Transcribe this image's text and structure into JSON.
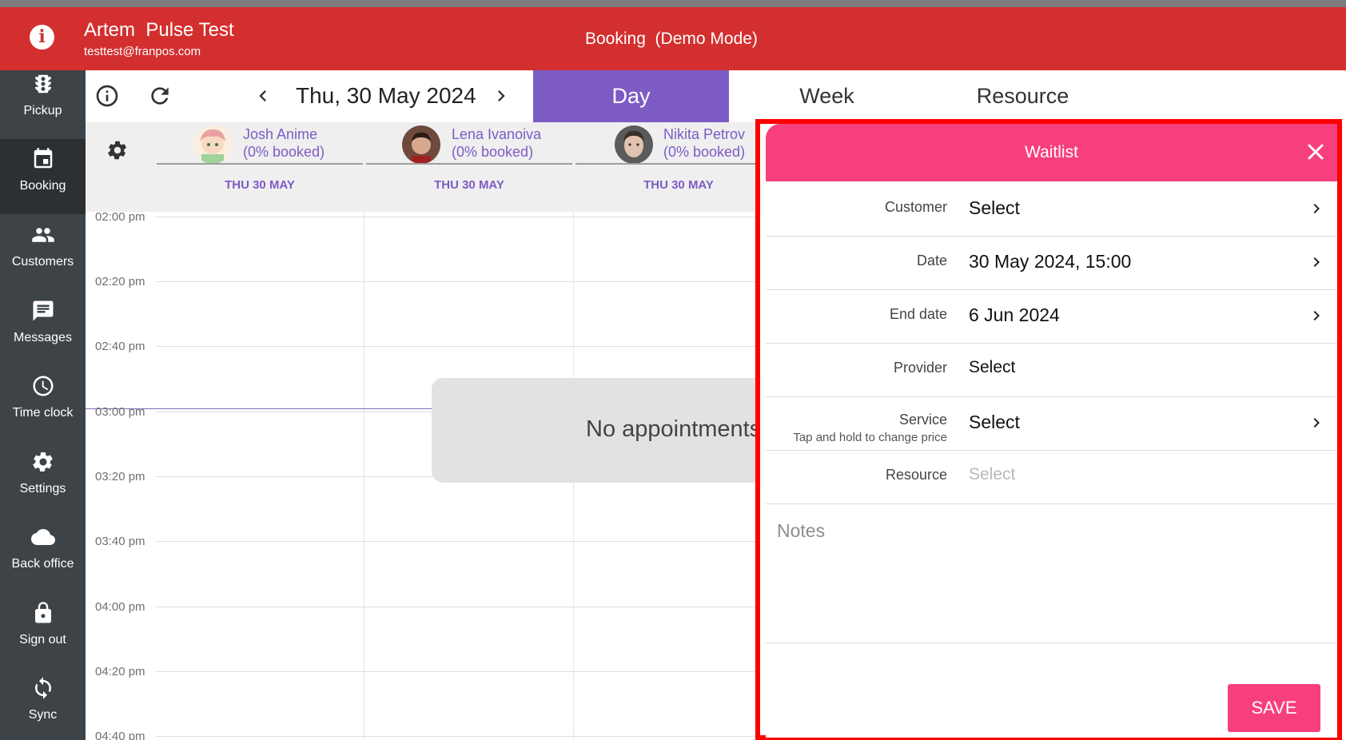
{
  "header": {
    "user_name": "Artem  Pulse Test",
    "user_email": "testtest@franpos.com",
    "title": "Booking  (Demo Mode)",
    "info_icon": "info-icon",
    "color": "#d32f2f"
  },
  "sidebar": {
    "items": [
      {
        "label": "Pickup",
        "icon": "traffic-light-icon"
      },
      {
        "label": "Booking",
        "icon": "calendar-icon"
      },
      {
        "label": "Customers",
        "icon": "people-icon"
      },
      {
        "label": "Messages",
        "icon": "message-icon"
      },
      {
        "label": "Time clock",
        "icon": "clock-icon"
      },
      {
        "label": "Settings",
        "icon": "gear-icon"
      },
      {
        "label": "Back office",
        "icon": "cloud-icon"
      },
      {
        "label": "Sign out",
        "icon": "lock-icon"
      },
      {
        "label": "Sync",
        "icon": "sync-icon"
      }
    ],
    "active": "Booking"
  },
  "toolbar": {
    "date": "Thu, 30 May 2024",
    "tabs": [
      {
        "label": "Day"
      },
      {
        "label": "Week"
      },
      {
        "label": "Resource"
      }
    ],
    "active_tab": "Day",
    "accent": "#7c5cc4"
  },
  "calendar": {
    "staff": [
      {
        "name": "Josh Anime",
        "booked": "(0% booked)",
        "day": "THU 30 MAY"
      },
      {
        "name": "Lena Ivanoiva",
        "booked": "(0% booked)",
        "day": "THU 30 MAY"
      },
      {
        "name": "Nikita Petrov",
        "booked": "(0% booked)",
        "day": "THU 30 MAY"
      }
    ],
    "times": [
      "02:00 pm",
      "02:20 pm",
      "02:40 pm",
      "03:00 pm",
      "03:20 pm",
      "03:40 pm",
      "04:00 pm",
      "04:20 pm",
      "04:40 pm"
    ],
    "empty_message": "No appointments"
  },
  "waitlist": {
    "title": "Waitlist",
    "color": "#f73f7e",
    "fields": [
      {
        "label": "Customer",
        "value": "Select"
      },
      {
        "label": "Date",
        "value": "30 May 2024, 15:00"
      },
      {
        "label": "End date",
        "value": "6 Jun 2024"
      },
      {
        "label": "Provider",
        "value": "Select"
      },
      {
        "label": "Service",
        "sub": "Tap and hold to change price",
        "value": "Select"
      },
      {
        "label": "Resource",
        "value": "Select"
      }
    ],
    "notes_placeholder": "Notes",
    "save_label": "SAVE"
  }
}
